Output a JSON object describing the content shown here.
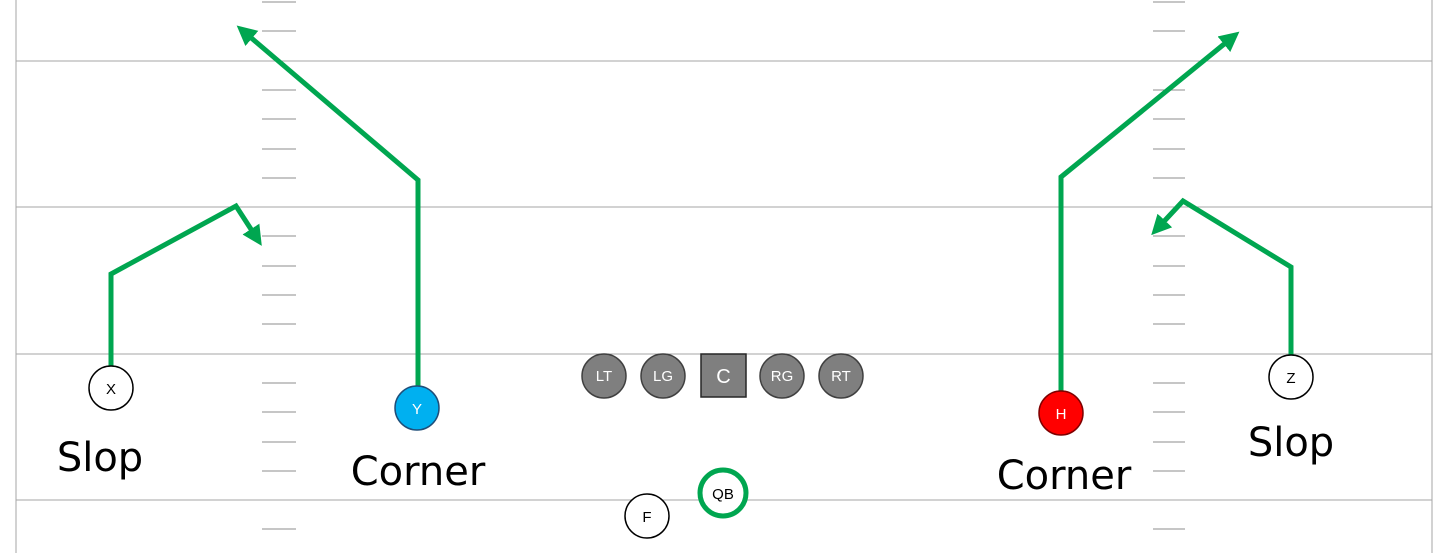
{
  "colors": {
    "route": "#00a650",
    "line": "#a6a6a6",
    "hash": "#8c8c8c",
    "lineman": "#7f7f7f",
    "y_fill": "#00b0f0",
    "h_fill": "#ff0000"
  },
  "players": {
    "x": "X",
    "y": "Y",
    "h": "H",
    "z": "Z",
    "lt": "LT",
    "lg": "LG",
    "c": "C",
    "rg": "RG",
    "rt": "RT",
    "qb": "QB",
    "f": "F"
  },
  "routes": {
    "x": "Slop",
    "y": "Corner",
    "h": "Corner",
    "z": "Slop"
  }
}
